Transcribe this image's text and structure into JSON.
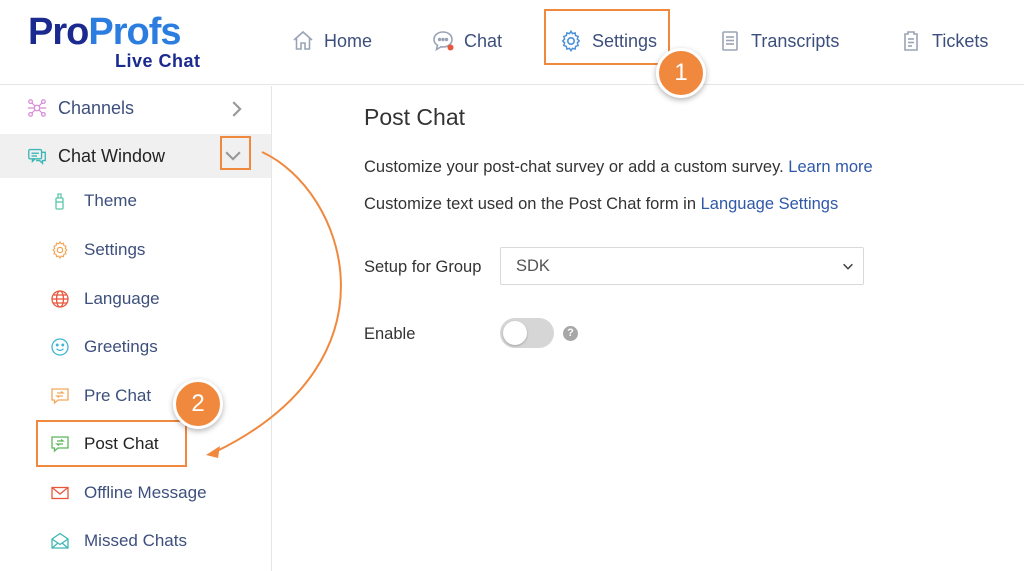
{
  "logo": {
    "brand_a": "Pro",
    "brand_b": "Profs",
    "sub": "Live Chat"
  },
  "nav": {
    "home": "Home",
    "chat": "Chat",
    "settings": "Settings",
    "transcripts": "Transcripts",
    "tickets": "Tickets"
  },
  "sidebar": {
    "channels": "Channels",
    "chat_window": "Chat Window",
    "items": [
      "Theme",
      "Settings",
      "Language",
      "Greetings",
      "Pre Chat",
      "Post Chat",
      "Offline Message",
      "Missed Chats"
    ]
  },
  "main": {
    "title": "Post Chat",
    "desc1_text": "Customize your post-chat survey or add a custom survey.",
    "desc1_link": "Learn more",
    "desc2_text": "Customize text used on the Post Chat form in",
    "desc2_link": "Language Settings",
    "group_label": "Setup for Group",
    "group_value": "SDK",
    "enable_label": "Enable",
    "enable_on": false,
    "help": "?"
  },
  "annotations": {
    "step1": "1",
    "step2": "2"
  },
  "colors": {
    "brand_dark": "#1b2a8f",
    "brand_light": "#2c7de0",
    "link": "#2f58a8",
    "annotation": "#f0883e"
  }
}
